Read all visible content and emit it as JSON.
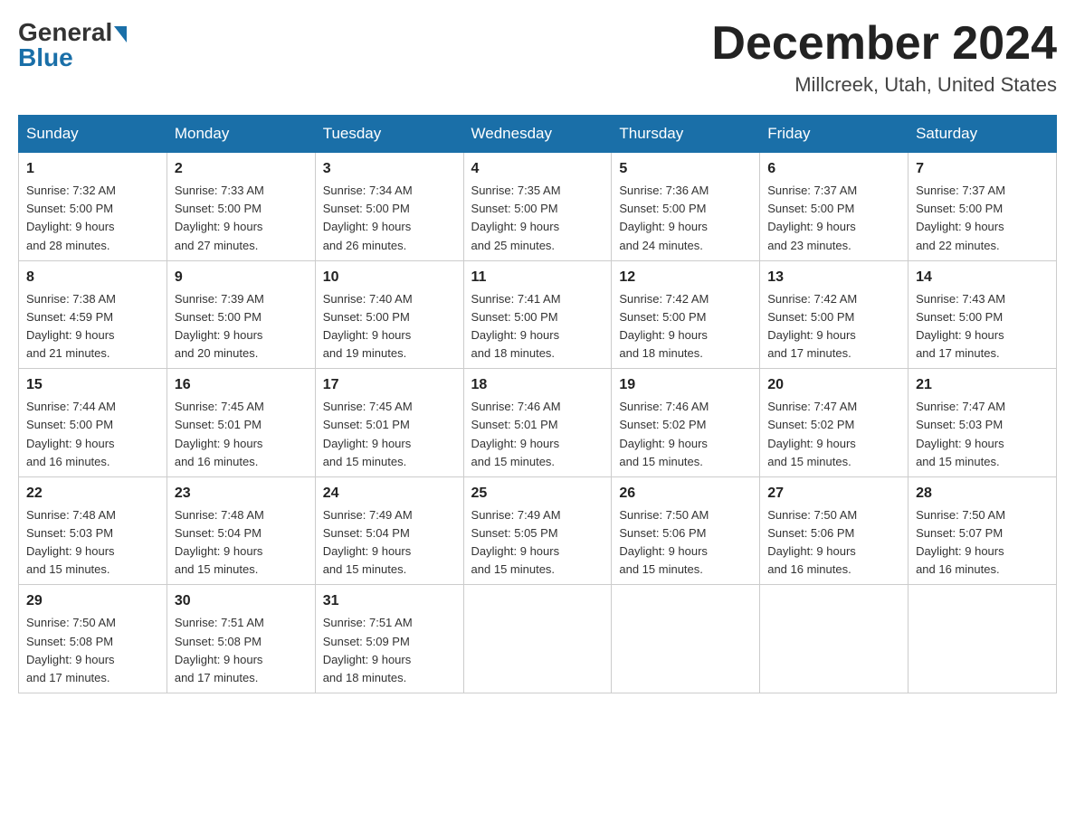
{
  "header": {
    "logo_general": "General",
    "logo_blue": "Blue",
    "title": "December 2024",
    "subtitle": "Millcreek, Utah, United States"
  },
  "days_of_week": [
    "Sunday",
    "Monday",
    "Tuesday",
    "Wednesday",
    "Thursday",
    "Friday",
    "Saturday"
  ],
  "weeks": [
    [
      {
        "day": "1",
        "sunrise": "7:32 AM",
        "sunset": "5:00 PM",
        "daylight": "9 hours and 28 minutes."
      },
      {
        "day": "2",
        "sunrise": "7:33 AM",
        "sunset": "5:00 PM",
        "daylight": "9 hours and 27 minutes."
      },
      {
        "day": "3",
        "sunrise": "7:34 AM",
        "sunset": "5:00 PM",
        "daylight": "9 hours and 26 minutes."
      },
      {
        "day": "4",
        "sunrise": "7:35 AM",
        "sunset": "5:00 PM",
        "daylight": "9 hours and 25 minutes."
      },
      {
        "day": "5",
        "sunrise": "7:36 AM",
        "sunset": "5:00 PM",
        "daylight": "9 hours and 24 minutes."
      },
      {
        "day": "6",
        "sunrise": "7:37 AM",
        "sunset": "5:00 PM",
        "daylight": "9 hours and 23 minutes."
      },
      {
        "day": "7",
        "sunrise": "7:37 AM",
        "sunset": "5:00 PM",
        "daylight": "9 hours and 22 minutes."
      }
    ],
    [
      {
        "day": "8",
        "sunrise": "7:38 AM",
        "sunset": "4:59 PM",
        "daylight": "9 hours and 21 minutes."
      },
      {
        "day": "9",
        "sunrise": "7:39 AM",
        "sunset": "5:00 PM",
        "daylight": "9 hours and 20 minutes."
      },
      {
        "day": "10",
        "sunrise": "7:40 AM",
        "sunset": "5:00 PM",
        "daylight": "9 hours and 19 minutes."
      },
      {
        "day": "11",
        "sunrise": "7:41 AM",
        "sunset": "5:00 PM",
        "daylight": "9 hours and 18 minutes."
      },
      {
        "day": "12",
        "sunrise": "7:42 AM",
        "sunset": "5:00 PM",
        "daylight": "9 hours and 18 minutes."
      },
      {
        "day": "13",
        "sunrise": "7:42 AM",
        "sunset": "5:00 PM",
        "daylight": "9 hours and 17 minutes."
      },
      {
        "day": "14",
        "sunrise": "7:43 AM",
        "sunset": "5:00 PM",
        "daylight": "9 hours and 17 minutes."
      }
    ],
    [
      {
        "day": "15",
        "sunrise": "7:44 AM",
        "sunset": "5:00 PM",
        "daylight": "9 hours and 16 minutes."
      },
      {
        "day": "16",
        "sunrise": "7:45 AM",
        "sunset": "5:01 PM",
        "daylight": "9 hours and 16 minutes."
      },
      {
        "day": "17",
        "sunrise": "7:45 AM",
        "sunset": "5:01 PM",
        "daylight": "9 hours and 15 minutes."
      },
      {
        "day": "18",
        "sunrise": "7:46 AM",
        "sunset": "5:01 PM",
        "daylight": "9 hours and 15 minutes."
      },
      {
        "day": "19",
        "sunrise": "7:46 AM",
        "sunset": "5:02 PM",
        "daylight": "9 hours and 15 minutes."
      },
      {
        "day": "20",
        "sunrise": "7:47 AM",
        "sunset": "5:02 PM",
        "daylight": "9 hours and 15 minutes."
      },
      {
        "day": "21",
        "sunrise": "7:47 AM",
        "sunset": "5:03 PM",
        "daylight": "9 hours and 15 minutes."
      }
    ],
    [
      {
        "day": "22",
        "sunrise": "7:48 AM",
        "sunset": "5:03 PM",
        "daylight": "9 hours and 15 minutes."
      },
      {
        "day": "23",
        "sunrise": "7:48 AM",
        "sunset": "5:04 PM",
        "daylight": "9 hours and 15 minutes."
      },
      {
        "day": "24",
        "sunrise": "7:49 AM",
        "sunset": "5:04 PM",
        "daylight": "9 hours and 15 minutes."
      },
      {
        "day": "25",
        "sunrise": "7:49 AM",
        "sunset": "5:05 PM",
        "daylight": "9 hours and 15 minutes."
      },
      {
        "day": "26",
        "sunrise": "7:50 AM",
        "sunset": "5:06 PM",
        "daylight": "9 hours and 15 minutes."
      },
      {
        "day": "27",
        "sunrise": "7:50 AM",
        "sunset": "5:06 PM",
        "daylight": "9 hours and 16 minutes."
      },
      {
        "day": "28",
        "sunrise": "7:50 AM",
        "sunset": "5:07 PM",
        "daylight": "9 hours and 16 minutes."
      }
    ],
    [
      {
        "day": "29",
        "sunrise": "7:50 AM",
        "sunset": "5:08 PM",
        "daylight": "9 hours and 17 minutes."
      },
      {
        "day": "30",
        "sunrise": "7:51 AM",
        "sunset": "5:08 PM",
        "daylight": "9 hours and 17 minutes."
      },
      {
        "day": "31",
        "sunrise": "7:51 AM",
        "sunset": "5:09 PM",
        "daylight": "9 hours and 18 minutes."
      },
      null,
      null,
      null,
      null
    ]
  ],
  "labels": {
    "sunrise": "Sunrise:",
    "sunset": "Sunset:",
    "daylight": "Daylight:"
  }
}
